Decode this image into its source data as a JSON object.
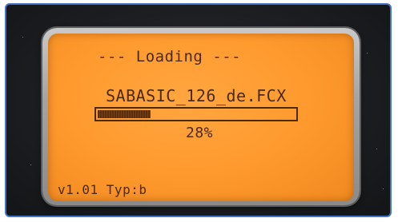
{
  "lcd": {
    "loading_title": "--- Loading ---",
    "file_name": "SABASIC_126_de.FCX",
    "progress_percent_label": "28%",
    "progress_value": 0.28,
    "version_line": "v1.01 Typ:b"
  },
  "colors": {
    "frame_border": "#3f74c9",
    "lcd_background": "#ff9a2e",
    "lcd_text": "#4a2a10"
  }
}
